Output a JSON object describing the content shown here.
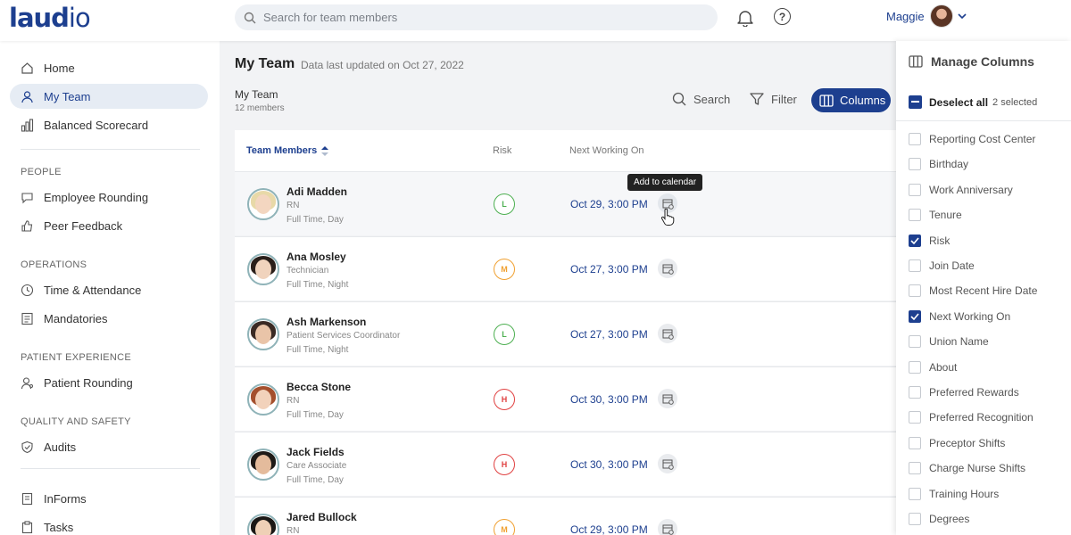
{
  "brand": {
    "logo_bold": "laud",
    "logo_light": "io"
  },
  "search": {
    "placeholder": "Search for team members"
  },
  "user": {
    "name": "Maggie"
  },
  "sidebar": {
    "items": [
      {
        "label": "Home"
      },
      {
        "label": "My Team"
      },
      {
        "label": "Balanced Scorecard"
      },
      {
        "label": "Employee Rounding"
      },
      {
        "label": "Peer Feedback"
      },
      {
        "label": "Time & Attendance"
      },
      {
        "label": "Mandatories"
      },
      {
        "label": "Patient Rounding"
      },
      {
        "label": "Audits"
      },
      {
        "label": "InForms"
      },
      {
        "label": "Tasks"
      }
    ],
    "sections": [
      "PEOPLE",
      "OPERATIONS",
      "PATIENT EXPERIENCE",
      "QUALITY AND SAFETY"
    ]
  },
  "main": {
    "title": "My Team",
    "updated": "Data last updated on Oct 27, 2022",
    "team_label": "My Team",
    "team_count": "12 members",
    "toolbar": {
      "search": "Search",
      "filter": "Filter",
      "columns": "Columns"
    },
    "columns": {
      "members": "Team Members",
      "risk": "Risk",
      "next": "Next Working On"
    },
    "tooltip": "Add to calendar",
    "rows": [
      {
        "name": "Adi Madden",
        "role": "RN",
        "shift": "Full Time, Day",
        "risk": "L",
        "date": "Oct 29, 3:00 PM"
      },
      {
        "name": "Ana Mosley",
        "role": "Technician",
        "shift": "Full Time, Night",
        "risk": "M",
        "date": "Oct 27, 3:00 PM"
      },
      {
        "name": "Ash Markenson",
        "role": "Patient Services Coordinator",
        "shift": "Full Time, Night",
        "risk": "L",
        "date": "Oct 27, 3:00 PM"
      },
      {
        "name": "Becca Stone",
        "role": "RN",
        "shift": "Full Time, Day",
        "risk": "H",
        "date": "Oct 30, 3:00 PM"
      },
      {
        "name": "Jack Fields",
        "role": "Care Associate",
        "shift": "Full Time, Day",
        "risk": "H",
        "date": "Oct 30, 3:00 PM"
      },
      {
        "name": "Jared Bullock",
        "role": "RN",
        "shift": "",
        "risk": "M",
        "date": "Oct 29, 3:00 PM"
      }
    ]
  },
  "panel": {
    "title": "Manage Columns",
    "deselect": "Deselect all",
    "selected_count": "2 selected",
    "options": [
      {
        "label": "Reporting Cost Center",
        "checked": false
      },
      {
        "label": "Birthday",
        "checked": false
      },
      {
        "label": "Work Anniversary",
        "checked": false
      },
      {
        "label": "Tenure",
        "checked": false
      },
      {
        "label": "Risk",
        "checked": true
      },
      {
        "label": "Join Date",
        "checked": false
      },
      {
        "label": "Most Recent Hire Date",
        "checked": false
      },
      {
        "label": "Next Working On",
        "checked": true
      },
      {
        "label": "Union Name",
        "checked": false
      },
      {
        "label": "About",
        "checked": false
      },
      {
        "label": "Preferred Rewards",
        "checked": false
      },
      {
        "label": "Preferred Recognition",
        "checked": false
      },
      {
        "label": "Preceptor Shifts",
        "checked": false
      },
      {
        "label": "Charge Nurse Shifts",
        "checked": false
      },
      {
        "label": "Training Hours",
        "checked": false
      },
      {
        "label": "Degrees",
        "checked": false
      }
    ]
  },
  "colors": {
    "primary": "#1d3f8f",
    "risk_low": "#4caf50",
    "risk_medium": "#f0a030",
    "risk_high": "#e04040"
  }
}
